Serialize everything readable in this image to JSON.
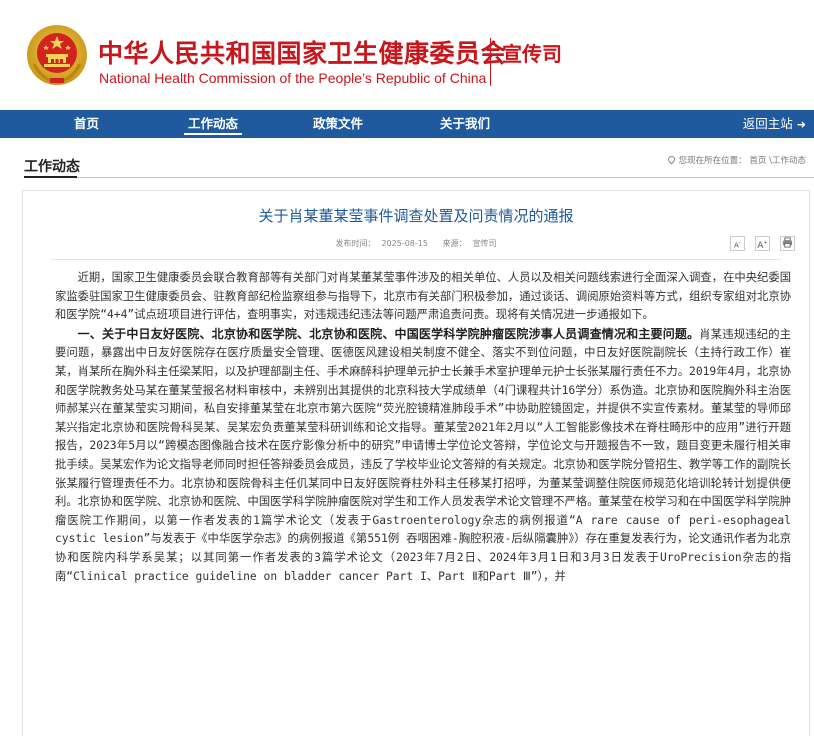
{
  "header": {
    "title_cn": "中华人民共和国国家卫生健康委员会",
    "title_en": "National Health Commission of the People’s Republic of China",
    "department": "宣传司",
    "colors": {
      "brand_red": "#c8161d",
      "nav_blue": "#1f5a9e",
      "link_blue": "#1f5a9e"
    }
  },
  "nav": {
    "items": [
      {
        "label": "首页"
      },
      {
        "label": "工作动态"
      },
      {
        "label": "政策文件"
      },
      {
        "label": "关于我们"
      }
    ],
    "active": "工作动态",
    "return_label": "返回主站"
  },
  "section": {
    "title": "工作动态",
    "breadcrumb_prefix": "您现在所在位置：",
    "breadcrumb_home": "首页",
    "breadcrumb_sep": "\\",
    "breadcrumb_current": "工作动态"
  },
  "article": {
    "title": "关于肖某董某莹事件调查处置及问责情况的通报",
    "meta": {
      "date_label": "发布时间：",
      "date": "2025-08-15",
      "source_label": "来源：",
      "source": "宣传司"
    },
    "tools": {
      "font_small": "A",
      "font_large": "A",
      "print": "print-icon"
    },
    "intro": "近期，国家卫生健康委员会联合教育部等有关部门对肖某董某莹事件涉及的相关单位、人员以及相关问题线索进行全面深入调查，在中央纪委国家监委驻国家卫生健康委员会、驻教育部纪检监察组参与指导下，北京市有关部门积极参加，通过谈话、调阅原始资料等方式，组织专家组对北京协和医学院“4+4”试点班项目进行评估，查明事实，对违规违纪违法等问题严肃追责问责。现将有关情况进一步通报如下。",
    "section1_heading": "一、关于中日友好医院、北京协和医学院、北京协和医院、中国医学科学院肿瘤医院涉事人员调查情况和主要问题。",
    "section1_body": "肖某违规违纪的主要问题，暴露出中日友好医院存在医疗质量安全管理、医德医风建设相关制度不健全、落实不到位问题，中日友好医院副院长（主持行政工作）崔某，肖某所在胸外科主任梁某阳，以及护理部副主任、手术麻醉科护理单元护士长兼手术室护理单元护士长张某履行责任不力。2019年4月，北京协和医学院教务处马某在董某莹报名材料审核中，未辨别出其提供的北京科技大学成绩单（4门课程共计16学分）系伪造。北京协和医院胸外科主治医师郝某兴在董某莹实习期间，私自安排董某莹在北京市第六医院“荧光腔镜精准肺段手术”中协助腔镜固定，并提供不实宣传素材。董某莹的导师邱某兴指定北京协和医院骨科吴某、吴某宏负责董某莹科研训练和论文指导。董某莹2021年2月以“人工智能影像技术在脊柱畸形中的应用”进行开题报告，2023年5月以“跨模态图像融合技术在医疗影像分析中的研究”申请博士学位论文答辩，学位论文与开题报告不一致，题目变更未履行相关审批手续。吴某宏作为论文指导老师同时担任答辩委员会成员，违反了学校毕业论文答辩的有关规定。北京协和医学院分管招生、教学等工作的副院长张某履行管理责任不力。北京协和医院骨科主任仉某同中日友好医院脊柱外科主任移某打招呼，为董某莹调整住院医师规范化培训轮转计划提供便利。北京协和医学院、北京协和医院、中国医学科学院肿瘤医院对学生和工作人员发表学术论文管理不严格。董某莹在校学习和在中国医学科学院肿瘤医院工作期间，以第一作者发表的1篇学术论文（发表于Gastroenterology杂志的病例报道“A rare cause of peri-esophageal cystic lesion”与发表于《中华医学杂志》的病例报道《第551例 吞咽困难-胸腔积液-后纵隔囊肿》）存在重复发表行为，论文通讯作者为北京协和医院内科学系吴某；以其同第一作者发表的3篇学术论文（2023年7月2日、2024年3月1日和3月3日发表于UroPrecision杂志的指南“Clinical practice guideline on bladder cancer Part I、Part Ⅱ和Part Ⅲ”），并"
  }
}
